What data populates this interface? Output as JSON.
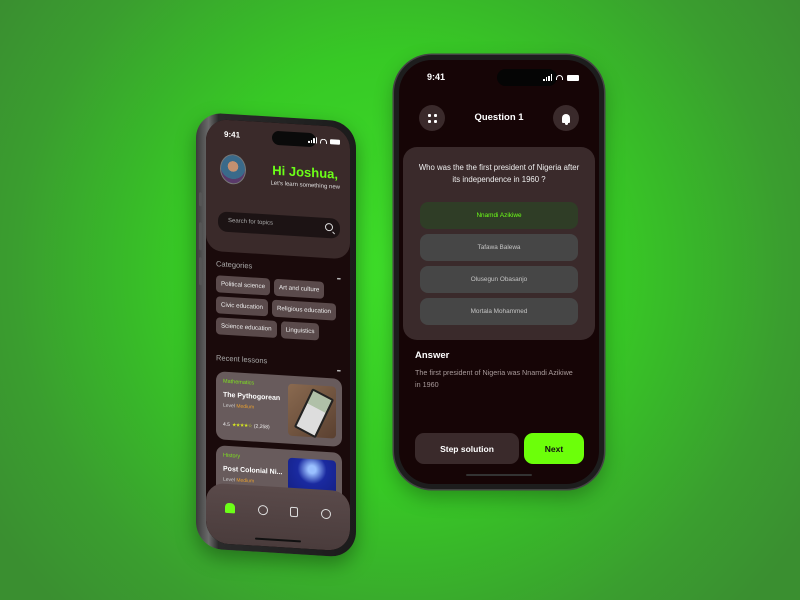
{
  "colors": {
    "accent": "#6cff18",
    "level": "#e8a030",
    "star": "#d6e820",
    "background": "#3fe02a"
  },
  "home_screen": {
    "status": {
      "time": "9:41"
    },
    "greeting": "Hi Joshua,",
    "subtitle": "Let's learn something new",
    "search": {
      "placeholder": "Search for topics",
      "icon": "search-icon"
    },
    "categories": {
      "title": "Categories",
      "more": "•••",
      "items": [
        "Political science",
        "Art and culture",
        "Civic education",
        "Religious education",
        "Science education",
        "Linguistics"
      ]
    },
    "recent": {
      "title": "Recent lessons",
      "more": "•••",
      "lessons": [
        {
          "subject": "Mathematics",
          "title": "The Pythogorean",
          "level_label": "Level",
          "level": "Medium",
          "rating": "4.5",
          "stars": "★★★★☆",
          "reviews": "(2,258)",
          "thumb": "calculator-image"
        },
        {
          "subject": "History",
          "title": "Post Colonial Ni...",
          "level_label": "Level",
          "level": "Medium",
          "thumb": "lightning-image"
        }
      ]
    },
    "nav": [
      {
        "name": "home",
        "icon": "home-icon",
        "active": true
      },
      {
        "name": "search",
        "icon": "search-icon",
        "active": false
      },
      {
        "name": "lessons",
        "icon": "book-icon",
        "active": false
      },
      {
        "name": "profile",
        "icon": "user-icon",
        "active": false
      }
    ]
  },
  "quiz_screen": {
    "status": {
      "time": "9:41"
    },
    "title": "Question 1",
    "menu_icon": "grid-icon",
    "bell_icon": "bell-icon",
    "question": "Who was the the first president of Nigeria after its independence in 1960 ?",
    "options": [
      {
        "label": "Nnamdi Azikiwe",
        "correct": true
      },
      {
        "label": "Tafawa Balewa",
        "correct": false
      },
      {
        "label": "Olusegun Obasanjo",
        "correct": false
      },
      {
        "label": "Mortala Mohammed",
        "correct": false
      }
    ],
    "answer_title": "Answer",
    "answer_text": "The  first president of Nigeria  was Nnamdi Azikiwe in 1960",
    "step_button": "Step solution",
    "next_button": "Next"
  }
}
